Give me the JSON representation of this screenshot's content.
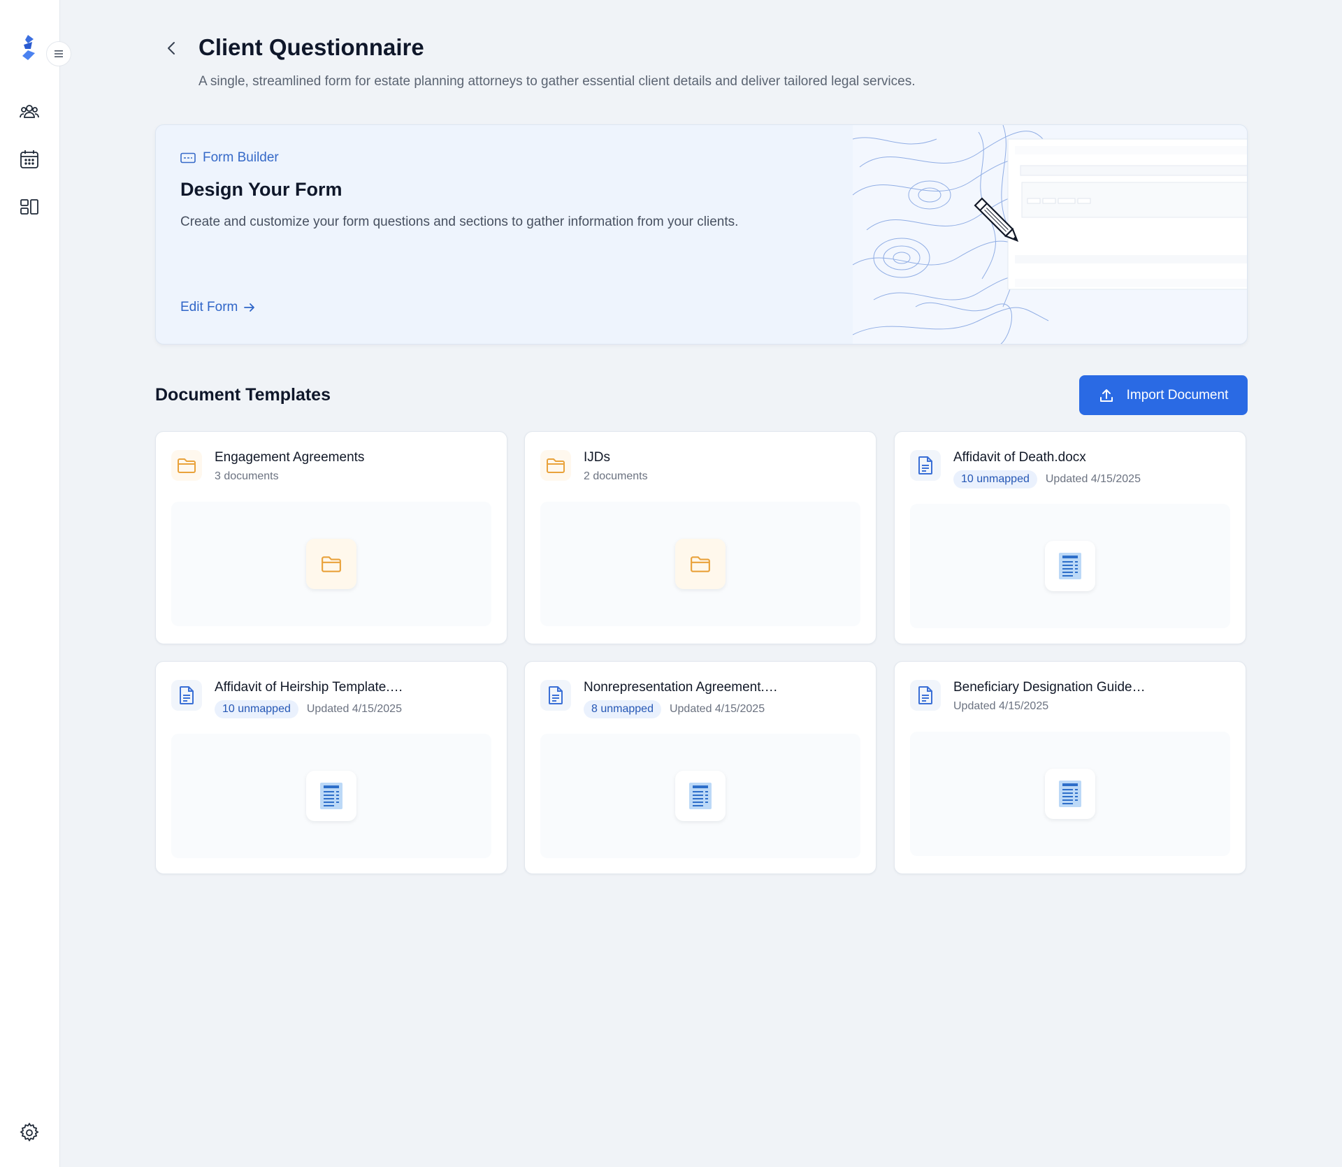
{
  "sidebar": {
    "icons": [
      "logo-icon",
      "menu-icon",
      "clients-icon",
      "calendar-icon",
      "templates-icon",
      "settings-icon"
    ]
  },
  "header": {
    "title": "Client Questionnaire",
    "subtitle": "A single, streamlined form for estate planning attorneys to gather essential client details and deliver tailored legal services."
  },
  "hero": {
    "tag": "Form Builder",
    "title": "Design Your Form",
    "description": "Create and customize your form questions and sections to gather information from your clients.",
    "link_label": "Edit Form"
  },
  "templates": {
    "section_title": "Document Templates",
    "import_label": "Import Document",
    "items": [
      {
        "type": "folder",
        "name": "Engagement Agreements",
        "count": "3 documents"
      },
      {
        "type": "folder",
        "name": "IJDs",
        "count": "2 documents"
      },
      {
        "type": "doc",
        "name": "Affidavit of Death.docx",
        "badge": "10 unmapped",
        "updated": "Updated 4/15/2025"
      },
      {
        "type": "doc",
        "name": "Affidavit of Heirship Template.…",
        "badge": "10 unmapped",
        "updated": "Updated 4/15/2025"
      },
      {
        "type": "doc",
        "name": "Nonrepresentation Agreement.…",
        "badge": "8 unmapped",
        "updated": "Updated 4/15/2025"
      },
      {
        "type": "doc",
        "name": "Beneficiary Designation Guide…",
        "updated": "Updated 4/15/2025"
      }
    ]
  },
  "colors": {
    "accent": "#2a6ae4",
    "folder": "#e9a23b",
    "doc": "#3a6fd6",
    "background": "#f0f3f7"
  }
}
